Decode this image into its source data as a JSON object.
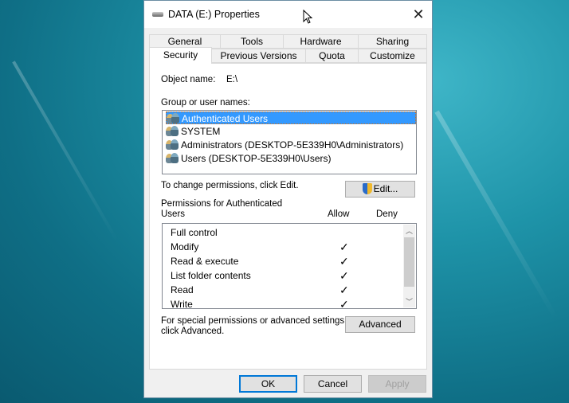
{
  "window": {
    "title": "DATA (E:) Properties",
    "close_icon": "close-icon"
  },
  "tabs": {
    "row1": [
      "General",
      "Tools",
      "Hardware",
      "Sharing"
    ],
    "row2": [
      "Security",
      "Previous Versions",
      "Quota",
      "Customize"
    ],
    "active": "Security"
  },
  "security": {
    "object_name_label": "Object name:",
    "object_name_value": "E:\\",
    "group_label": "Group or user names:",
    "groups": [
      "Authenticated Users",
      "SYSTEM",
      "Administrators (DESKTOP-5E339H0\\Administrators)",
      "Users (DESKTOP-5E339H0\\Users)"
    ],
    "selected_group": "Authenticated Users",
    "change_hint": "To change permissions, click Edit.",
    "edit_button": "Edit...",
    "permissions_label_line1": "Permissions for Authenticated",
    "permissions_label_line2": "Users",
    "allow_header": "Allow",
    "deny_header": "Deny",
    "permissions": [
      {
        "name": "Full control",
        "allow": false,
        "deny": false
      },
      {
        "name": "Modify",
        "allow": true,
        "deny": false
      },
      {
        "name": "Read & execute",
        "allow": true,
        "deny": false
      },
      {
        "name": "List folder contents",
        "allow": true,
        "deny": false
      },
      {
        "name": "Read",
        "allow": true,
        "deny": false
      },
      {
        "name": "Write",
        "allow": true,
        "deny": false
      }
    ],
    "check_glyph": "✓",
    "advanced_hint_line1": "For special permissions or advanced settings,",
    "advanced_hint_line2": "click Advanced.",
    "advanced_button": "Advanced"
  },
  "footer": {
    "ok": "OK",
    "cancel": "Cancel",
    "apply": "Apply"
  },
  "colors": {
    "selection": "#3399ff",
    "default_button_border": "#0078d7"
  }
}
